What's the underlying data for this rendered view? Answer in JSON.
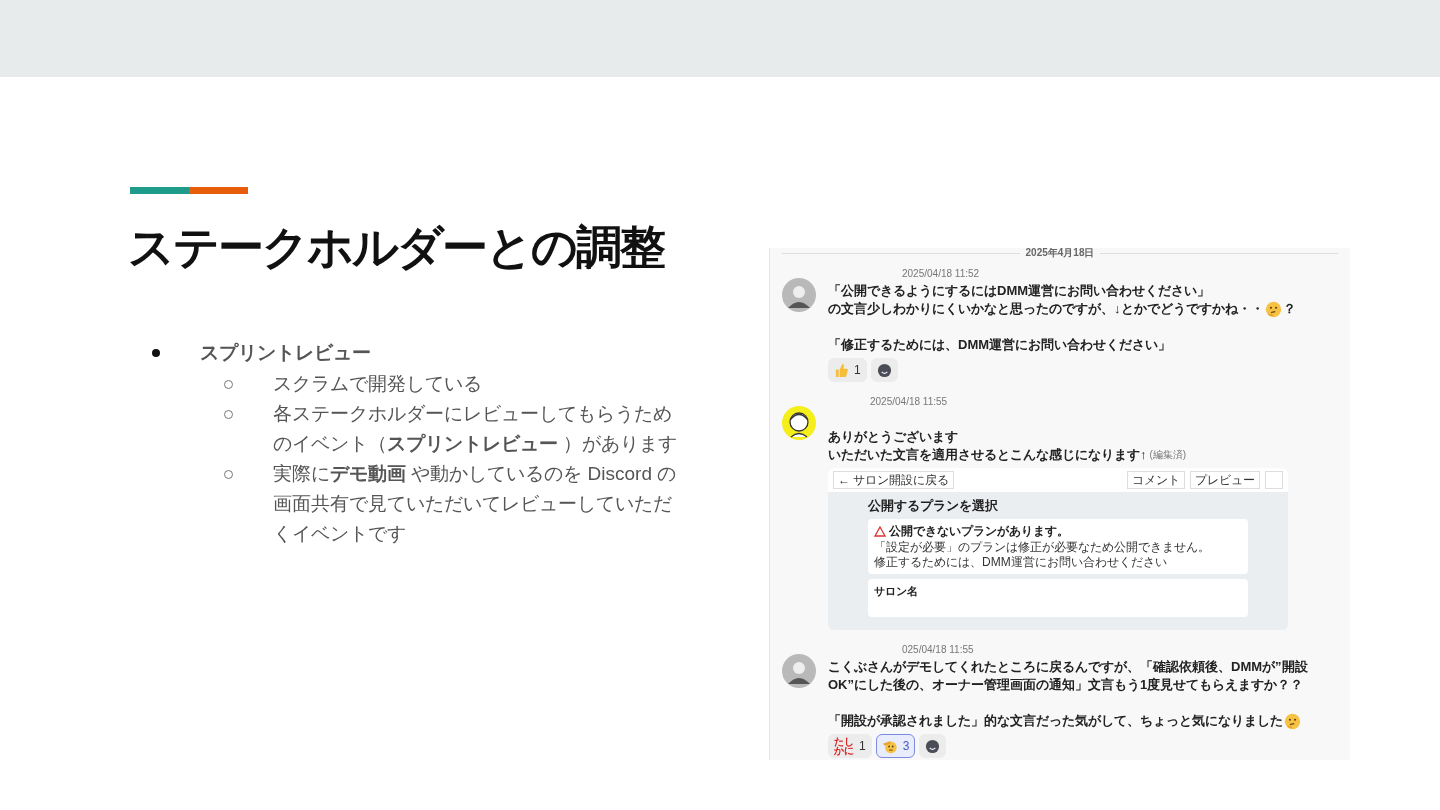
{
  "slide": {
    "title": "ステークホルダーとの調整",
    "bullets": [
      {
        "text": "スプリントレビュー",
        "children": [
          {
            "text": "スクラムで開発している"
          },
          {
            "text": "各ステークホルダーにレビューしてもらうためのイベント（**スプリントレビュー** ）があります"
          },
          {
            "text": "実際に**デモ動画** や動かしているのを Discord の画面共有で見ていただいてレビューしていただくイベントです"
          }
        ]
      }
    ]
  },
  "chat": {
    "date": "2025年4月18日",
    "messages": [
      {
        "kind": "photo",
        "time": "2025/04/18 11:52",
        "paragraphs": [
          {
            "blank_before": false,
            "parts": [
              {
                "kind": "text",
                "text": "「公開できるようにするにはDMM運営にお問い合わせください」"
              }
            ]
          },
          {
            "blank_before": false,
            "parts": [
              {
                "kind": "text",
                "text": "の文言少しわかりにくいかなと思ったのですが、↓とかでどうですかね・・"
              },
              {
                "kind": "emoji"
              },
              {
                "kind": "text",
                "text": "？"
              }
            ]
          },
          {
            "blank_before": true,
            "parts": [
              {
                "kind": "text",
                "text": "「修正するためには、DMM運営にお問い合わせください」"
              }
            ]
          }
        ],
        "reactions": [
          {
            "kind": "thumbs",
            "count": "1",
            "selected": false
          },
          {
            "kind": "add",
            "selected": false
          }
        ]
      },
      {
        "kind": "illustration",
        "time": "2025/04/18 11:55",
        "paragraphs": [
          {
            "blank_before": true,
            "parts": [
              {
                "kind": "text",
                "text": "ありがとうございます"
              }
            ]
          },
          {
            "blank_before": false,
            "parts": [
              {
                "kind": "text",
                "text": "いただいた文言を適用させるとこんな感じになります↑"
              },
              {
                "kind": "note",
                "text": "(編集済)"
              }
            ]
          }
        ],
        "attachment": {
          "back_link": "← サロン開設に戻る",
          "buttons": [
            "コメント",
            "プレビュー"
          ],
          "title": "公開するプランを選択",
          "alert_title": "公開できないプランがあります。",
          "alert_lines": [
            "「設定が必要」のプランは修正が必要なため公開できません。",
            "修正するためには、DMM運営にお問い合わせください"
          ],
          "field_label": "サロン名"
        }
      },
      {
        "kind": "photo",
        "time": "025/04/18 11:55",
        "paragraphs": [
          {
            "blank_before": false,
            "parts": [
              {
                "kind": "text",
                "text": "こくぶさんがデモしてくれたところに戻るんですが、「確認依頼後、DMMが”開設OK”にした後の、オーナー管理画面の通知」文言もう1度見せてもらえますか？？"
              }
            ]
          },
          {
            "blank_before": true,
            "parts": [
              {
                "kind": "text",
                "text": "「開設が承認されました」的な文言だった気がして、ちょっと気になりました"
              },
              {
                "kind": "emoji"
              }
            ]
          }
        ],
        "reactions": [
          {
            "kind": "stamp",
            "label": "たしかに",
            "count": "1",
            "selected": false
          },
          {
            "kind": "salute",
            "count": "3",
            "selected": true
          },
          {
            "kind": "add",
            "selected": false
          }
        ]
      }
    ]
  }
}
